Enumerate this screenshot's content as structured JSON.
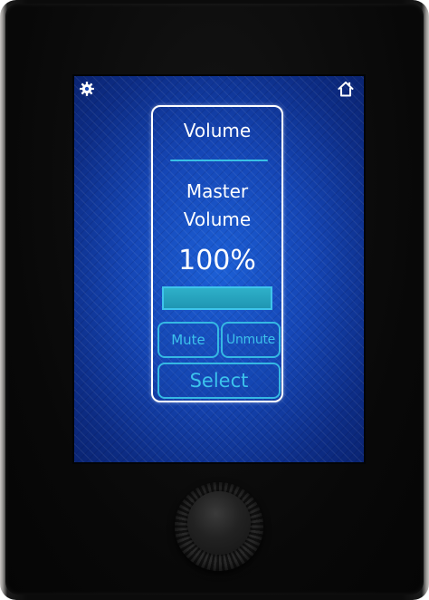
{
  "header": {
    "left_icon": "gear-icon",
    "right_icon": "home-icon"
  },
  "panel": {
    "title": "Volume",
    "channel_name_line1": "Master",
    "channel_name_line2": "Volume",
    "level_text": "100%",
    "level_fraction": 1.0
  },
  "buttons": {
    "mute_label": "Mute",
    "unmute_label": "Unmute",
    "select_label": "Select"
  },
  "colors": {
    "screen_background": "#1546b5",
    "accent": "#35b8e3",
    "text": "#ffffff",
    "level_fill": "#2eb0c9"
  },
  "hardware": {
    "control": "rotary-knob"
  }
}
